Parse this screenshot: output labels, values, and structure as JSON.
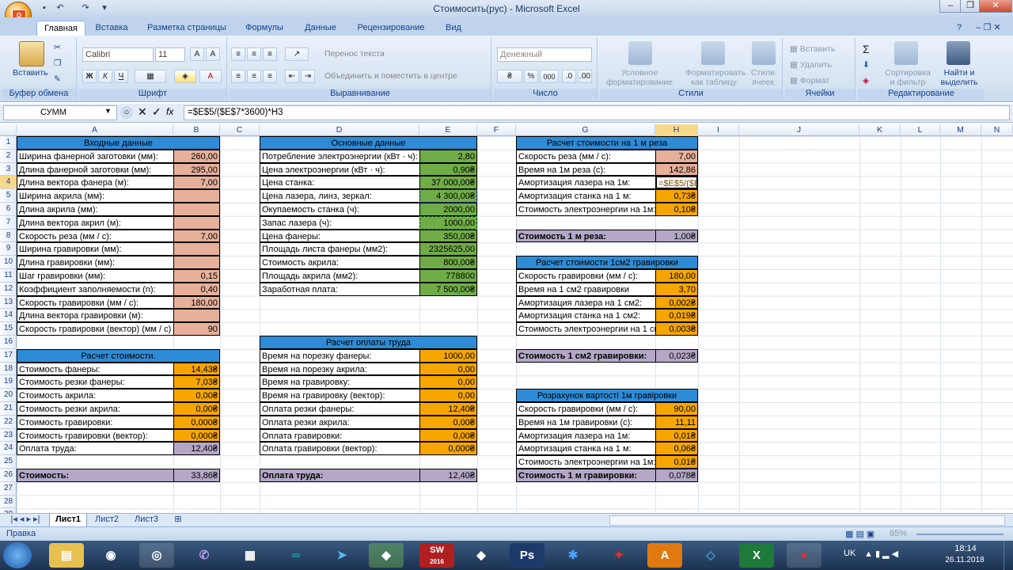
{
  "window": {
    "title": "Стоимосить(рус) - Microsoft Excel",
    "office_button": "O",
    "qat_icons": [
      "save-icon",
      "undo-icon",
      "redo-icon"
    ]
  },
  "tabs": [
    "Главная",
    "Вставка",
    "Разметка страницы",
    "Формулы",
    "Данные",
    "Рецензирование",
    "Вид"
  ],
  "ribbon": {
    "groups": [
      "Буфер обмена",
      "Шрифт",
      "Выравнивание",
      "Число",
      "Стили",
      "Ячейки",
      "Редактирование"
    ],
    "paste_label": "Вставить",
    "font_name": "Calibri",
    "font_size": "11",
    "bold": "Ж",
    "italic": "К",
    "underline": "Ч",
    "wrap_text": "Перенос текста",
    "merge_center": "Объединить и поместить в центре",
    "number_format": "Денежный",
    "percent": "%",
    "thousands": "000",
    "cond_format": "Условное форматирование",
    "format_table": "Форматировать как таблицу",
    "cell_styles": "Стили ячеек",
    "insert": "Вставить",
    "delete": "Удалить",
    "format": "Формат",
    "sort_filter": "Сортировка и фильтр",
    "find_select": "Найти и выделить",
    "autosum": "Σ"
  },
  "formula_bar": {
    "name_box": "СУММ",
    "fx": "fx",
    "formula": "=$E$5/($E$7*3600)*H3"
  },
  "columns": [
    "A",
    "B",
    "C",
    "D",
    "E",
    "F",
    "G",
    "H",
    "I",
    "J",
    "K",
    "L",
    "M",
    "N"
  ],
  "rows": [
    "1",
    "2",
    "3",
    "4",
    "5",
    "6",
    "7",
    "8",
    "9",
    "10",
    "11",
    "12",
    "13",
    "14",
    "15",
    "16",
    "17",
    "18",
    "19",
    "20",
    "21",
    "22",
    "23",
    "24",
    "25",
    "26",
    "27",
    "28",
    "29"
  ],
  "block_input": {
    "header": "Входные данные",
    "labels": [
      "Ширина фанерной заготовки (мм):",
      "Длина фанерной заготовки (мм):",
      "Длина вектора фанера (м):",
      "Ширина акрила (мм):",
      "Длина акрила (мм):",
      "Длина вектора акрил (м):",
      "Скорость реза (мм / с):",
      "Ширина гравировки (мм):",
      "Длина гравировки (мм):",
      "Шаг гравировки (мм):",
      "Коэффициент заполняемости (n):",
      "Скорость гравировки (мм / с):",
      "Длина вектора гравировки (м):",
      "Скорость гравировки (вектор) (мм / с)"
    ],
    "values": [
      "260,00",
      "295,00",
      "7,00",
      "",
      "",
      "",
      "7,00",
      "",
      "",
      "0,15",
      "0,40",
      "180,00",
      "",
      "90"
    ]
  },
  "block_cost": {
    "header": "Расчет стоимости.",
    "labels": [
      "Стоимость фанеры:",
      "Стоимость резки фанеры:",
      "Стоимость акрила:",
      "Стоимость резки акрила:",
      "Стоимость гравировки:",
      "Стоимость гравировки (вектор):",
      "Оплата труда:"
    ],
    "values": [
      "14,43₴",
      "7,03₴",
      "0,00₴",
      "0,00₴",
      "0,000₴",
      "0,000₴",
      "12,40₴"
    ],
    "total_label": "Стоимость:",
    "total_value": "33,86₴"
  },
  "block_main": {
    "header": "Основные данные",
    "labels": [
      "Потребление электроэнергии (кВт · ч):",
      "Цена электроэнергии (кВт · ч):",
      "Цена станка:",
      "Цена лазера, линз, зеркал:",
      "Окупаемость станка (ч):",
      "Запас лазера (ч):",
      "Цена фанеры:",
      "Площадь листа фанеры (мм2):",
      "Стоимость акрила:",
      "Площадь акрила (мм2):",
      "Заработная плата:"
    ],
    "values": [
      "2,80",
      "0,90₴",
      "37 000,00₴",
      "4 300,00₴",
      "2000,00",
      "1000,00",
      "350,00₴",
      "2325625,00",
      "800,00₴",
      "778800",
      "7 500,00₴"
    ]
  },
  "block_labor": {
    "header": "Расчет оплаты труда",
    "labels": [
      "Время на порезку фанеры:",
      "Время на порезку акрила:",
      "Время на гравировку:",
      "Время на гравировку (вектор):",
      "Оплата резки фанеры:",
      "Оплата резки акрила:",
      "Оплата гравировки:",
      "Оплата гравировки (вектор):"
    ],
    "values": [
      "1000,00",
      "0,00",
      "0,00",
      "0,00",
      "12,40₴",
      "0,00₴",
      "0,00₴",
      "0,000₴"
    ],
    "total_label": "Оплата труда:",
    "total_value": "12,40₴"
  },
  "block_cut": {
    "header": "Расчет стоимости на 1 м реза",
    "labels": [
      "Скорость реза (мм / с):",
      "Время на 1м реза (с):",
      "Амортизация лазера на 1м:",
      "Амортизация станка на 1 м:",
      "Стоимость электроэнергии на 1м:"
    ],
    "values": [
      "7,00",
      "142,86",
      "=$E$5/($E$",
      "0,73₴",
      "0,10₴"
    ],
    "total_label": "Стоимость 1 м реза:",
    "total_value": "1,00₴"
  },
  "block_engrave": {
    "header": "Расчет стоимости 1см2 гравировки",
    "labels": [
      "Скорость гравировки (мм / с):",
      "Время на 1 см2 гравировки",
      "Амортизация лазера на 1 см2:",
      "Амортизация станка на 1 см2:",
      "Стоимость электроэнергии на 1 см"
    ],
    "values": [
      "180,00",
      "3,70",
      "0,002₴",
      "0,019₴",
      "0,003₴"
    ],
    "total_label": "Стоимость 1 см2 гравировки:",
    "total_value": "0,023₴"
  },
  "block_vector": {
    "header": "Розрахунок вартості 1м гравіровки",
    "labels": [
      "Скорость гравировки (мм / с):",
      "Время на 1м гравировки (с):",
      "Амортизация лазера на 1м:",
      "Амортизация станка на 1 м:",
      "Стоимость электроэнергии на 1м:"
    ],
    "values": [
      "90,00",
      "11,11",
      "0,01₴",
      "0,06₴",
      "0,01₴"
    ],
    "total_label": "Стоимость 1 м гравировки:",
    "total_value": "0,078₴"
  },
  "sheet_tabs": [
    "Лист1",
    "Лист2",
    "Лист3"
  ],
  "status": {
    "mode": "Правка",
    "zoom": "85%"
  },
  "taskbar": {
    "lang": "UK",
    "time": "18:14",
    "date": "26.11.2018",
    "sw_label": "SW",
    "sw_year": "2016"
  },
  "colors": {
    "header_blue": "#2e8bd6",
    "input_salmon": "#e6b09a",
    "green": "#70ad47",
    "orange": "#f7a600",
    "purple": "#b4a7c6",
    "ribbon": "#d7e4f2"
  }
}
